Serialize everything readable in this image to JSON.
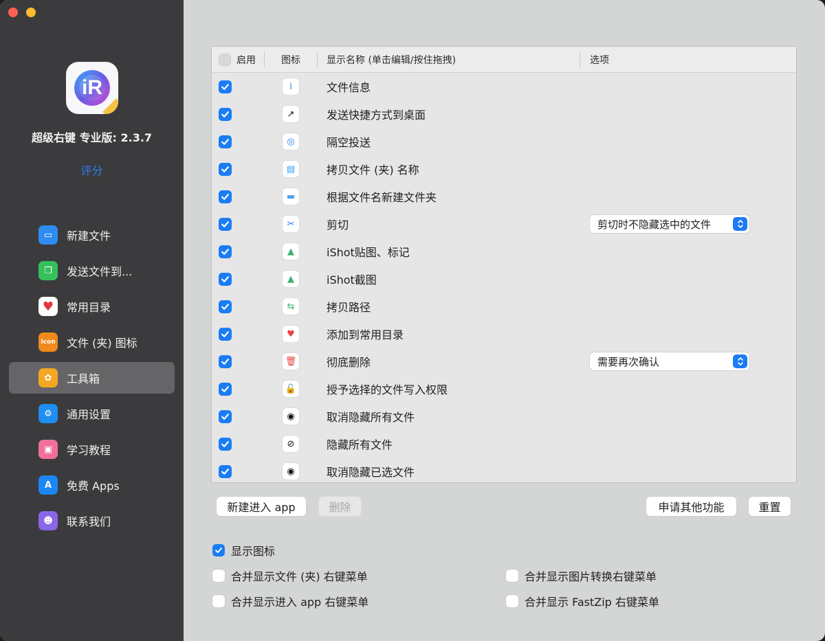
{
  "app": {
    "name": "超级右键 专业版: 2.3.7",
    "rate_link": "评分",
    "icon_letter": "iR"
  },
  "sidebar": {
    "items": [
      {
        "label": "新建文件",
        "icon": "new-file-icon",
        "color": "#2e8cf0",
        "glyph": "▭"
      },
      {
        "label": "发送文件到...",
        "icon": "send-file-icon",
        "color": "#34c05a",
        "glyph": "❐"
      },
      {
        "label": "常用目录",
        "icon": "heart-icon",
        "color": "#ffffff",
        "glyph": "♥"
      },
      {
        "label": "文件 (夹) 图标",
        "icon": "icon-badge-icon",
        "color": "#f08a1c",
        "glyph": "Icon"
      },
      {
        "label": "工具箱",
        "icon": "toolbox-icon",
        "color": "#f5a623",
        "glyph": "✿"
      },
      {
        "label": "通用设置",
        "icon": "gear-icon",
        "color": "#1f8ef1",
        "glyph": "⚙"
      },
      {
        "label": "学习教程",
        "icon": "tutorial-icon",
        "color": "#f06f9b",
        "glyph": "▣"
      },
      {
        "label": "免费 Apps",
        "icon": "app-store-icon",
        "color": "#1c86f5",
        "glyph": "A"
      },
      {
        "label": "联系我们",
        "icon": "contacts-icon",
        "color": "#8a67e6",
        "glyph": "☻"
      }
    ],
    "active_index": 4
  },
  "table": {
    "headers": {
      "enable": "启用",
      "icon": "图标",
      "name": "显示名称 (单击编辑/按住拖拽)",
      "options": "选项"
    },
    "rows": [
      {
        "label": "文件信息",
        "icon": "info-icon",
        "glyph": "i",
        "glyph_color": "#1b7cf5",
        "checked": true,
        "option": null
      },
      {
        "label": "发送快捷方式到桌面",
        "icon": "shortcut-arrow-icon",
        "glyph": "↗",
        "glyph_color": "#111111",
        "checked": true,
        "option": null
      },
      {
        "label": "隔空投送",
        "icon": "airdrop-icon",
        "glyph": "◎",
        "glyph_color": "#1b7cf5",
        "checked": true,
        "option": null
      },
      {
        "label": "拷贝文件 (夹) 名称",
        "icon": "copy-name-icon",
        "glyph": "▤",
        "glyph_color": "#2a9df4",
        "checked": true,
        "option": null
      },
      {
        "label": "根据文件名新建文件夹",
        "icon": "folder-icon",
        "glyph": "▬",
        "glyph_color": "#4aa3f0",
        "checked": true,
        "option": null
      },
      {
        "label": "剪切",
        "icon": "scissors-icon",
        "glyph": "✂",
        "glyph_color": "#1b7cf5",
        "checked": true,
        "option": "剪切时不隐藏选中的文件"
      },
      {
        "label": "iShot贴图、标记",
        "icon": "image-icon",
        "glyph": "▲",
        "glyph_color": "#3cb371",
        "checked": true,
        "option": null
      },
      {
        "label": "iShot截图",
        "icon": "image-icon",
        "glyph": "▲",
        "glyph_color": "#3cb371",
        "checked": true,
        "option": null
      },
      {
        "label": "拷贝路径",
        "icon": "path-icon",
        "glyph": "⇆",
        "glyph_color": "#3cb371",
        "checked": true,
        "option": null
      },
      {
        "label": "添加到常用目录",
        "icon": "heart-add-icon",
        "glyph": "♥",
        "glyph_color": "#e8423f",
        "checked": true,
        "option": null
      },
      {
        "label": "彻底删除",
        "icon": "trash-icon",
        "glyph": "🗑",
        "glyph_color": "#e8423f",
        "checked": true,
        "option": "需要再次确认"
      },
      {
        "label": "授予选择的文件写入权限",
        "icon": "unlock-icon",
        "glyph": "🔓",
        "glyph_color": "#f5a623",
        "checked": true,
        "option": null
      },
      {
        "label": "取消隐藏所有文件",
        "icon": "eye-icon",
        "glyph": "◉",
        "glyph_color": "#111111",
        "checked": true,
        "option": null
      },
      {
        "label": "隐藏所有文件",
        "icon": "eye-slash-icon",
        "glyph": "⊘",
        "glyph_color": "#111111",
        "checked": true,
        "option": null
      },
      {
        "label": "取消隐藏已选文件",
        "icon": "eye-icon",
        "glyph": "◉",
        "glyph_color": "#111111",
        "checked": true,
        "option": null
      }
    ]
  },
  "buttons": {
    "new_enter_app": "新建进入 app",
    "delete": "删除",
    "request_feature": "申请其他功能",
    "reset": "重置"
  },
  "options": {
    "show_icon": {
      "label": "显示图标",
      "checked": true
    },
    "merge_folder_menu": {
      "label": "合并显示文件 (夹) 右键菜单",
      "checked": false
    },
    "merge_enter_app_menu": {
      "label": "合并显示进入 app 右键菜单",
      "checked": false
    },
    "merge_image_convert_menu": {
      "label": "合并显示图片转换右键菜单",
      "checked": false
    },
    "merge_fastzip_menu": {
      "label": "合并显示 FastZip 右键菜单",
      "checked": false
    }
  },
  "colors": {
    "accent": "#1b7cf5",
    "sidebar_bg": "#3b3b3d",
    "content_bg": "#d4d6d6"
  }
}
